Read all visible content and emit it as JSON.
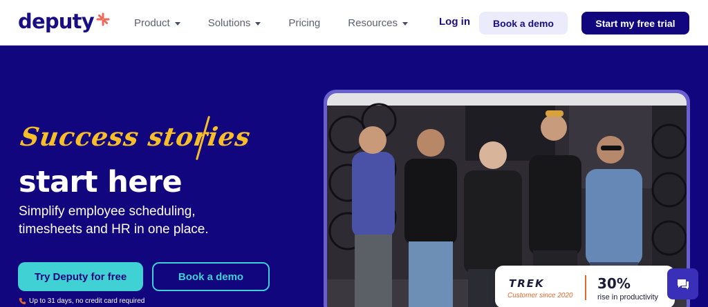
{
  "nav": {
    "logo_text": "deputy",
    "menu": [
      {
        "label": "Product",
        "has_dropdown": true
      },
      {
        "label": "Solutions",
        "has_dropdown": true
      },
      {
        "label": "Pricing",
        "has_dropdown": false
      },
      {
        "label": "Resources",
        "has_dropdown": true
      }
    ],
    "login_label": "Log in",
    "demo_label": "Book a demo",
    "trial_label": "Start my free trial"
  },
  "hero": {
    "script_title": "Success stories",
    "title": "start here",
    "subtitle": "Simplify employee scheduling, timesheets and HR in one place.",
    "primary_cta": "Try Deputy for free",
    "secondary_cta": "Book a demo",
    "note": "Up to 31 days, no credit card required"
  },
  "stat_card": {
    "brand": "TREK",
    "customer_since": "Customer since 2020",
    "stat_value": "30%",
    "stat_label": "rise in productivity"
  },
  "icons": {
    "logo_mark": "asterisk-burst-icon",
    "note_icon": "phone-icon",
    "chat_icon": "chat-bubble-icon",
    "dropdown": "caret-down-icon"
  },
  "colors": {
    "brand_navy": "#11067d",
    "accent_teal": "#3fd1d3",
    "accent_yellow": "#f8be2a",
    "accent_orange": "#e4682b",
    "demo_button_bg": "#ebebfb"
  }
}
